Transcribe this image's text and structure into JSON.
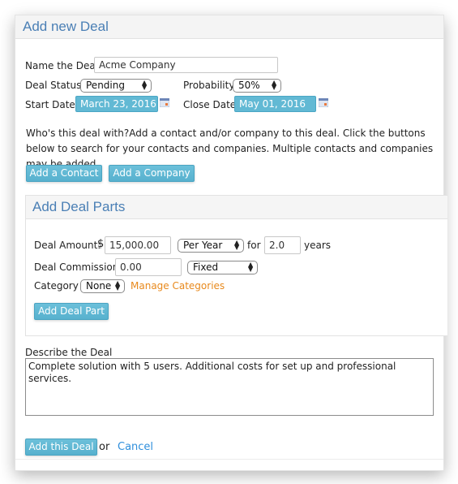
{
  "panel": {
    "title": "Add new Deal"
  },
  "deal": {
    "name_label": "Name the Deal:",
    "name_value": "Acme Company",
    "status_label": "Deal Status:",
    "status_value": "Pending",
    "probability_label": "Probability:",
    "probability_value": "50%",
    "start_date_label": "Start Date:",
    "start_date_value": "March 23, 2016",
    "close_date_label": "Close Date:",
    "close_date_value": "May 01, 2016",
    "calendar_icon": "calendar-icon"
  },
  "contacts": {
    "description": "Who's this deal with?Add a contact and/or company to this deal. Click the buttons below to search for your contacts and companies. Multiple contacts and companies may be added.",
    "add_contact_label": "Add a Contact",
    "add_company_label": "Add a Company"
  },
  "deal_parts": {
    "title": "Add Deal Parts",
    "amount_label": "Deal Amount:",
    "currency_symbol": "$",
    "amount_value": "15,000.00",
    "period_value": "Per Year",
    "for_label": "for",
    "duration_value": "2.0",
    "years_label": "years",
    "commission_label": "Deal Commission:",
    "commission_value": "0.00",
    "commission_type_value": "Fixed",
    "category_label": "Category",
    "category_value": "None",
    "manage_categories_label": "Manage Categories",
    "add_part_label": "Add Deal Part"
  },
  "description": {
    "label": "Describe the Deal",
    "value": "Complete solution with 5 users. Additional costs for set up and professional services."
  },
  "footer": {
    "submit_label": "Add this Deal",
    "or_label": "or",
    "cancel_label": "Cancel"
  },
  "colors": {
    "accent_blue": "#62b9d4",
    "title_blue": "#4a7fb5",
    "link_orange": "#e8891c",
    "link_blue": "#2f8fdc"
  }
}
